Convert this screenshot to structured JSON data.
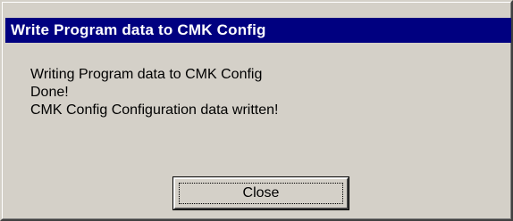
{
  "dialog": {
    "title": "Write Program data to CMK Config",
    "message_lines": [
      "Writing Program data to CMK Config",
      "Done!",
      "CMK Config Configuration data written!"
    ],
    "close_label": "Close"
  }
}
